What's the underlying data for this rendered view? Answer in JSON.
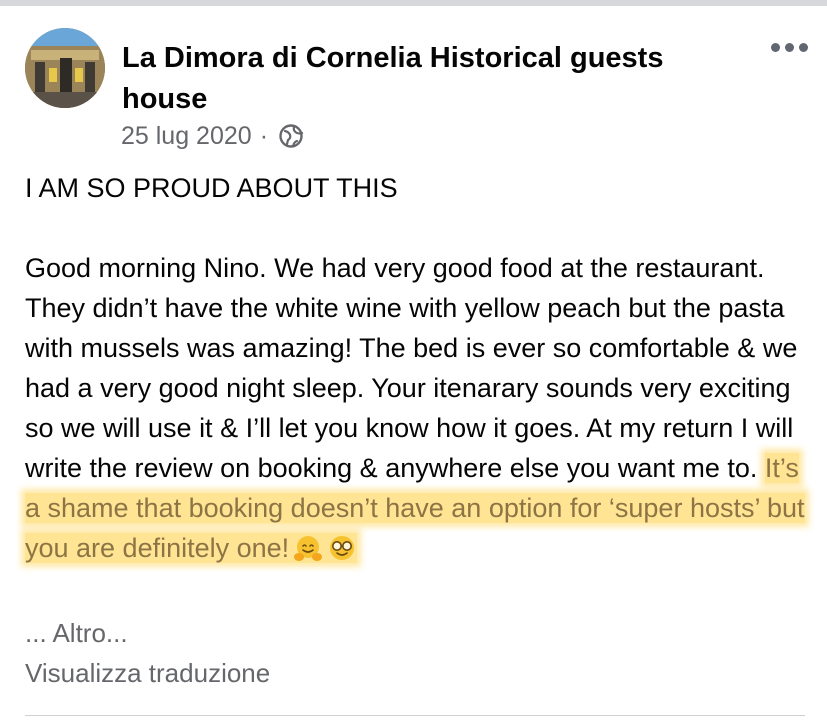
{
  "post": {
    "author": "La Dimora di Cornelia Historical guests house",
    "date": "25 lug 2020",
    "separator": "·",
    "audience_icon": "globe-icon",
    "more_icon": "more-options-icon",
    "headline": "I AM SO PROUD ABOUT THIS",
    "body_plain": "Good morning Nino. We had very good food at the restaurant. They  didn’t have the white wine with yellow peach but the pasta with mussels was amazing! The bed is ever so comfortable & we had a very good night sleep. Your itenarary sounds very exciting so we will use it & I’ll let you know how it goes. At my return I will write the review on booking & anywhere else you want me to. ",
    "body_highlighted": "It’s a shame that booking doesn’t have an option for ‘super hosts’ but you are definitely one!",
    "emojis": [
      "hugging-face-icon",
      "nerd-face-icon"
    ],
    "see_more": "... Altro...",
    "see_translation": "Visualizza traduzione"
  },
  "colors": {
    "highlight": "#ffce3c",
    "meta_text": "#65676b",
    "divider": "#ced0d4"
  }
}
